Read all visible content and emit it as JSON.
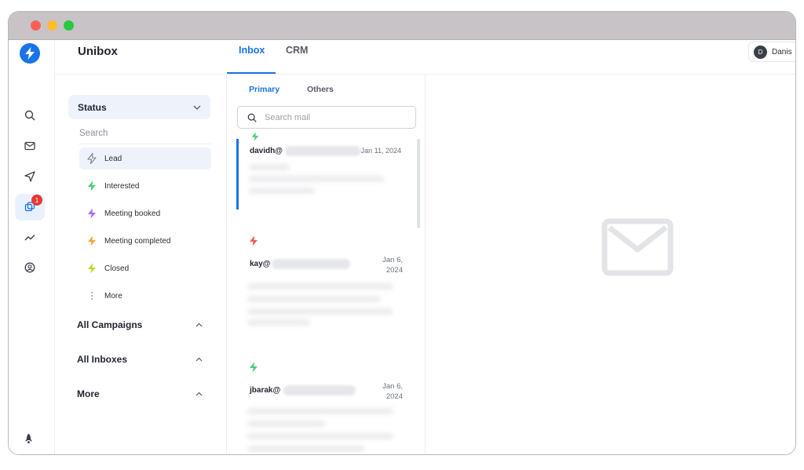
{
  "app": {
    "brand": "Unibox"
  },
  "rail": {
    "icons": [
      "search-icon",
      "mail-icon",
      "send-icon",
      "unibox-icon",
      "analytics-icon",
      "account-icon",
      "rocket-icon"
    ],
    "badge_count": "1"
  },
  "header": {
    "tabs": [
      {
        "label": "Inbox",
        "active": true
      },
      {
        "label": "CRM",
        "active": false
      }
    ],
    "user": {
      "initial": "D",
      "name": "Danis"
    }
  },
  "filters": {
    "status_title": "Status",
    "search_placeholder": "Search",
    "status_items": [
      {
        "label": "Lead",
        "color": "#7a8090",
        "active": true
      },
      {
        "label": "Interested",
        "color": "#4cd07a"
      },
      {
        "label": "Meeting booked",
        "color": "#a66cf0"
      },
      {
        "label": "Meeting completed",
        "color": "#f2a63b"
      },
      {
        "label": "Closed",
        "color": "#b3dd2b"
      },
      {
        "label": "More",
        "color": "#7a8090"
      }
    ],
    "sections": [
      {
        "label": "All Campaigns"
      },
      {
        "label": "All Inboxes"
      },
      {
        "label": "More"
      }
    ]
  },
  "mail_list": {
    "sub_tabs": [
      {
        "label": "Primary",
        "active": true
      },
      {
        "label": "Others",
        "active": false
      }
    ],
    "search_placeholder": "Search mail",
    "items": [
      {
        "sender": "davidh@",
        "date": "Jan 11, 2024",
        "status_color": "#4cd07a"
      },
      {
        "sender": "kay@",
        "date_line1": "Jan 6,",
        "date_line2": "2024",
        "status_color": "#ef5b5b"
      },
      {
        "sender": "jbarak@",
        "date_line1": "Jan 6,",
        "date_line2": "2024",
        "status_color": "#4cd07a"
      }
    ]
  },
  "colors": {
    "accent": "#1a73e8",
    "badge": "#e53935"
  }
}
